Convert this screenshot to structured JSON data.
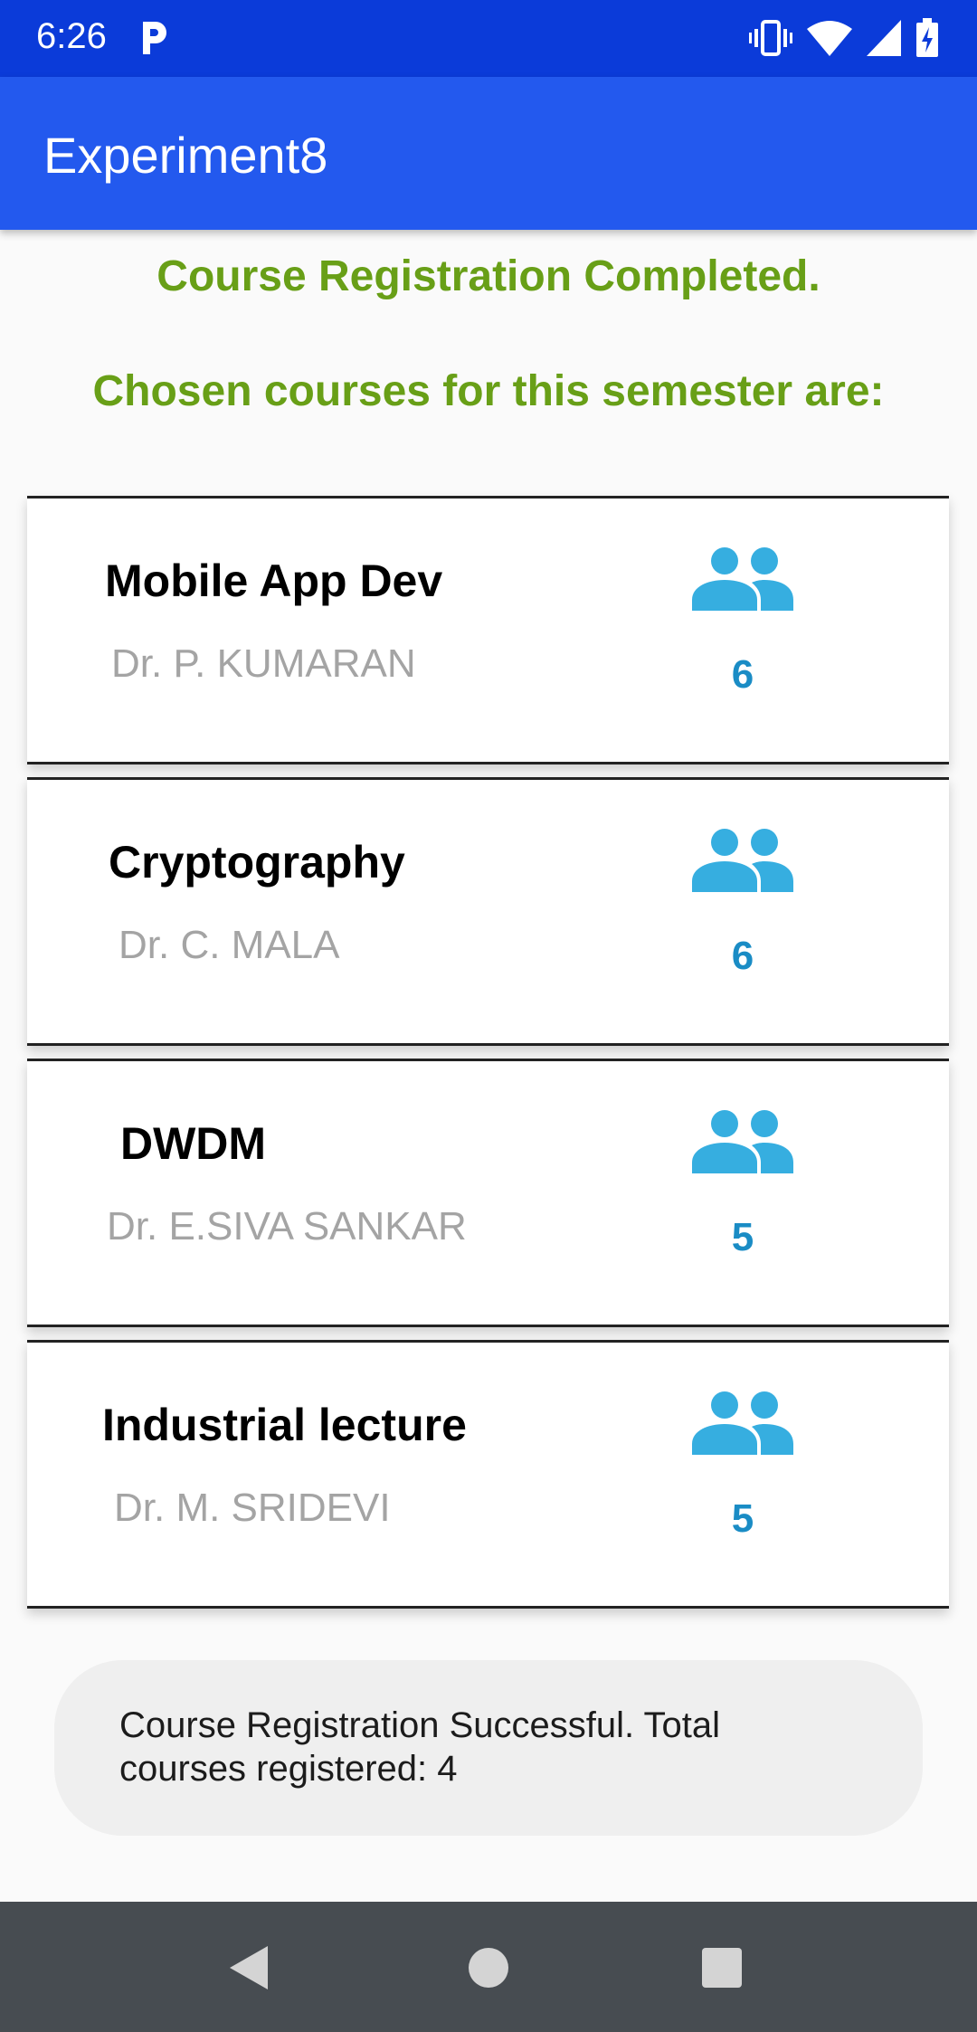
{
  "status_bar": {
    "time": "6:26",
    "icons": [
      "parking-icon",
      "vibrate-icon",
      "wifi-icon",
      "cellular-signal-icon",
      "battery-charging-icon"
    ]
  },
  "app_bar": {
    "title": "Experiment8",
    "color": "#2359ee"
  },
  "content": {
    "headline1": "Course Registration Completed.",
    "headline2": "Chosen courses for this semester are:",
    "headline_color": "#689f17",
    "courses": [
      {
        "name": "Mobile App Dev",
        "professor": "Dr. P. KUMARAN",
        "count": "6",
        "icon": "people-icon"
      },
      {
        "name": "Cryptography",
        "professor": "Dr. C. MALA",
        "count": "6",
        "icon": "people-icon"
      },
      {
        "name": "DWDM",
        "professor": "Dr. E.SIVA SANKAR",
        "count": "5",
        "icon": "people-icon"
      },
      {
        "name": "Industrial lecture",
        "professor": "Dr. M. SRIDEVI",
        "count": "5",
        "icon": "people-icon"
      }
    ],
    "icon_color": "#36aee0",
    "count_color": "#1a8cc5"
  },
  "toast": {
    "message": "Course Registration Successful. Total courses registered: 4"
  },
  "nav_bar": {
    "buttons": [
      "back-icon",
      "home-icon",
      "recents-icon"
    ]
  }
}
